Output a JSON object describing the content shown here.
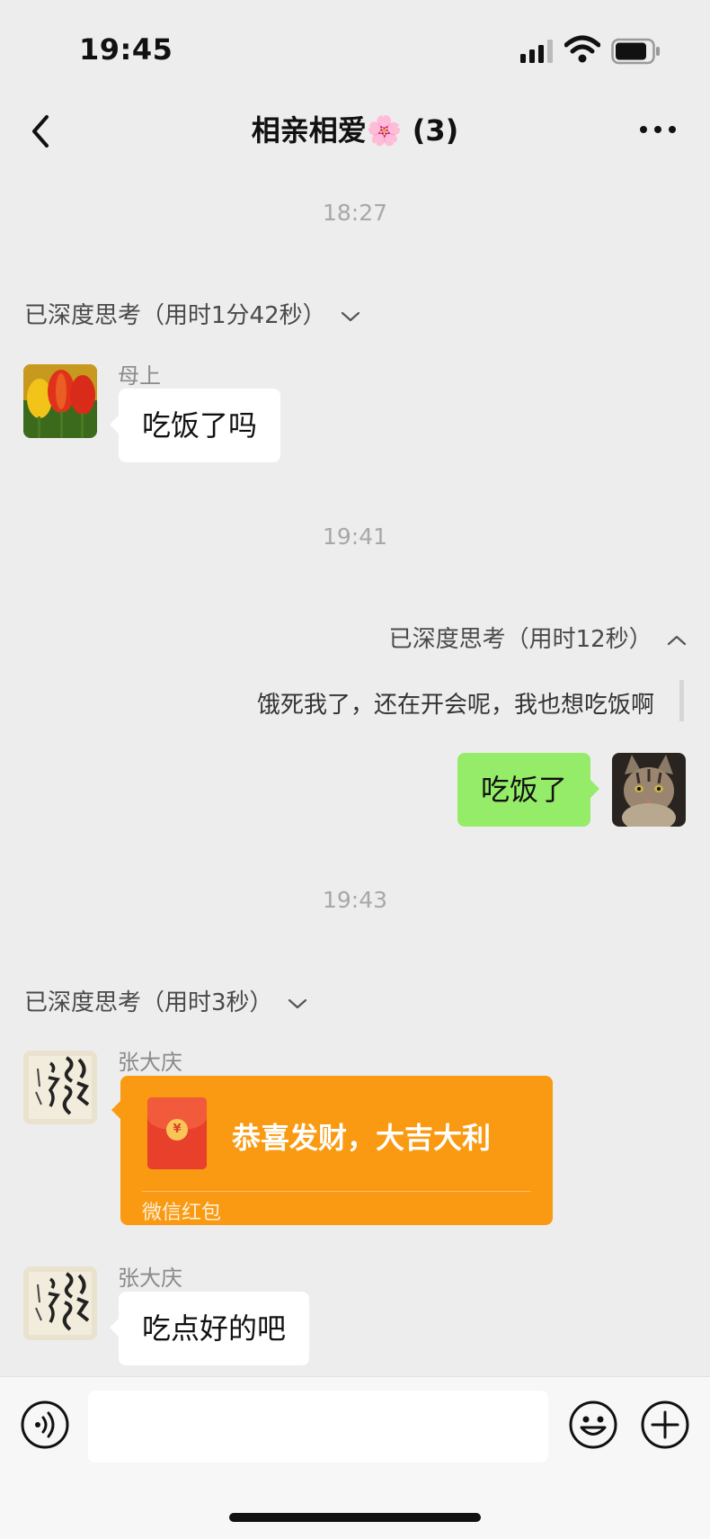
{
  "status_bar": {
    "time": "19:45"
  },
  "header": {
    "title": "相亲相爱🌸 (3)"
  },
  "messages": {
    "ts1": "18:27",
    "think1": "已深度思考（用时1分42秒）",
    "msg1_name": "母上",
    "msg1_text": "吃饭了吗",
    "ts2": "19:41",
    "think2": "已深度思考（用时12秒）",
    "think2_content": "饿死我了，还在开会呢，我也想吃饭啊",
    "msg2_text": "吃饭了",
    "ts3": "19:43",
    "think3": "已深度思考（用时3秒）",
    "msg3_name": "张大庆",
    "red_packet_title": "恭喜发财，大吉大利",
    "red_packet_label": "微信红包",
    "msg4_name": "张大庆",
    "msg4_text": "吃点好的吧"
  },
  "icons": {
    "back": "chevron-left-icon",
    "more": "ellipsis-icon",
    "voice": "voice-icon",
    "emoji": "emoji-icon",
    "plus": "plus-icon"
  },
  "colors": {
    "background": "#EDEDED",
    "my_bubble": "#95EC69",
    "red_packet": "#F99A12"
  }
}
